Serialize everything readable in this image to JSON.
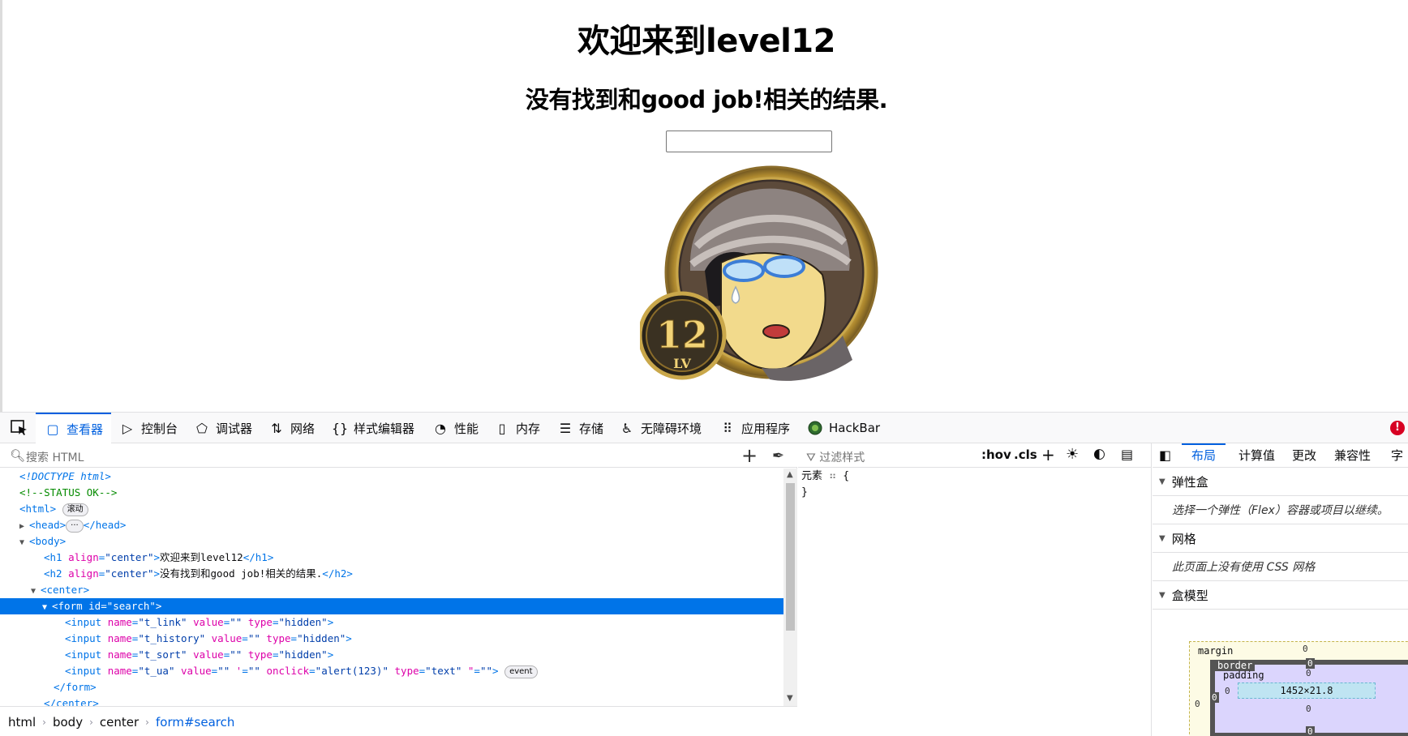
{
  "page": {
    "h1": "欢迎来到level12",
    "h2": "没有找到和good job!相关的结果.",
    "search_value": ""
  },
  "avatar": {
    "level": "12",
    "lv": "LV"
  },
  "devtools": {
    "tabs": [
      {
        "label": "查看器",
        "icon": "inspector-icon"
      },
      {
        "label": "控制台",
        "icon": "console-icon"
      },
      {
        "label": "调试器",
        "icon": "debugger-icon"
      },
      {
        "label": "网络",
        "icon": "network-icon"
      },
      {
        "label": "样式编辑器",
        "icon": "style-editor-icon"
      },
      {
        "label": "性能",
        "icon": "performance-icon"
      },
      {
        "label": "内存",
        "icon": "memory-icon"
      },
      {
        "label": "存储",
        "icon": "storage-icon"
      },
      {
        "label": "无障碍环境",
        "icon": "accessibility-icon"
      },
      {
        "label": "应用程序",
        "icon": "application-icon"
      },
      {
        "label": "HackBar",
        "icon": "hackbar-icon"
      }
    ],
    "active_tab": "查看器",
    "error_badge": "!"
  },
  "inspector": {
    "search_placeholder": "搜索 HTML",
    "lines": {
      "doctype": "<!DOCTYPE html>",
      "comment": "<!--STATUS OK-->",
      "html_open": "<html>",
      "scroll_badge": "滚动",
      "head": "<head>",
      "head_close": "</head>",
      "body_open": "<body>",
      "h1_text": "欢迎来到level12",
      "h2_text": "没有找到和good job!相关的结果.",
      "center_open": "<center>",
      "form_open": "<form id=\"search\">",
      "form_close": "</form>",
      "center_close": "</center>",
      "event_badge": "event"
    },
    "inputs": [
      {
        "name": "t_link",
        "value": "",
        "type": "hidden"
      },
      {
        "name": "t_history",
        "value": "",
        "type": "hidden"
      },
      {
        "name": "t_sort",
        "value": "",
        "type": "hidden"
      },
      {
        "name": "t_ua",
        "value": "",
        "extra_attr": "'",
        "extra_val": "",
        "onclick": "alert(123)",
        "type": "text",
        "last_attr": "\""
      }
    ],
    "breadcrumbs": [
      "html",
      "body",
      "center",
      "form#search"
    ]
  },
  "rules": {
    "filter_placeholder": "过滤样式",
    "hov": ":hov",
    "cls": ".cls",
    "element_label": "元素",
    "brace_open": "{",
    "brace_close": "}"
  },
  "layout": {
    "tabs": [
      "布局",
      "计算值",
      "更改",
      "兼容性",
      "字"
    ],
    "flex_title": "弹性盒",
    "flex_hint": "选择一个弹性（Flex）容器或项目以继续。",
    "grid_title": "网格",
    "grid_hint": "此页面上没有使用 CSS 网格",
    "box_title": "盒模型",
    "box": {
      "margin_label": "margin",
      "border_label": "border",
      "padding_label": "padding",
      "margin_top": "0",
      "margin_left": "0",
      "border_top": "0",
      "border_left": "0",
      "padding_top": "0",
      "padding_left": "0",
      "padding_bottom": "0",
      "border_bottom": "0",
      "content_size": "1452×21.8"
    }
  }
}
